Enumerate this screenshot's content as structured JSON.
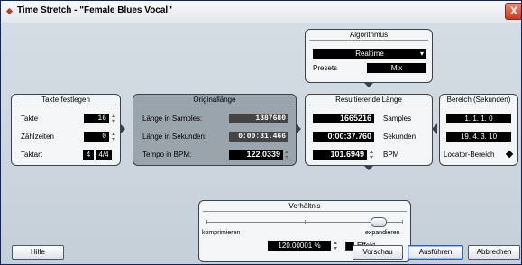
{
  "window": {
    "title": "Time Stretch - \"Female Blues Vocal\"",
    "close_label": "X"
  },
  "algorithmus": {
    "title": "Algorithmus",
    "algorithm_value": "Realtime",
    "presets_label": "Presets",
    "presets_value": "Mix"
  },
  "takte": {
    "title": "Takte festlegen",
    "rows": [
      {
        "label": "Takte",
        "value": "16"
      },
      {
        "label": "Zählzeiten",
        "value": "0"
      },
      {
        "label": "Taktart",
        "value_num": "4",
        "value": "4/4"
      }
    ]
  },
  "original": {
    "title": "Originallänge",
    "rows": [
      {
        "label": "Länge in Samples:",
        "value": "1387680"
      },
      {
        "label": "Länge in Sekunden:",
        "value": "0:00:31.466"
      },
      {
        "label": "Tempo in BPM:",
        "value": "122.0339"
      }
    ]
  },
  "result": {
    "title": "Resultierende Länge",
    "rows": [
      {
        "label": "Samples",
        "value": "1665216"
      },
      {
        "label": "Sekunden",
        "value": "0:00:37.760"
      },
      {
        "label": "BPM",
        "value": "101.6949"
      }
    ]
  },
  "bereich": {
    "title": "Bereich (Sekunden)",
    "start": "1. 1. 1.   0",
    "end": "19. 4. 3. 10",
    "locator_label": "Locator-Bereich"
  },
  "verhaeltnis": {
    "title": "Verhältnis",
    "left_label": "komprimieren",
    "right_label": "expandieren",
    "slider_position": 0.87,
    "value": "120.00001 %",
    "effekt_label": "Effekt"
  },
  "buttons": {
    "help": "Hilfe",
    "preview": "Vorschau",
    "execute": "Ausführen",
    "cancel": "Abbrechen"
  }
}
